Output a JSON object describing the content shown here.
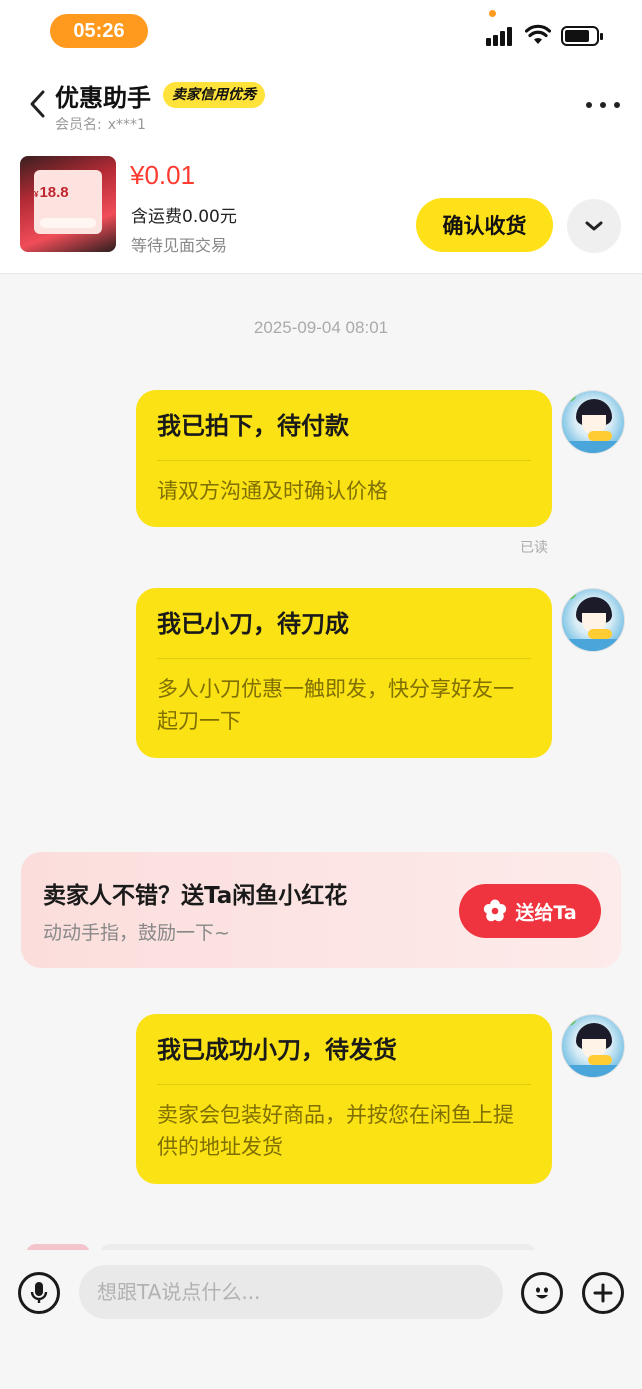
{
  "status_bar": {
    "time": "05:26",
    "accent_color": "#ff9a1f"
  },
  "header": {
    "title": "优惠助手",
    "badge": "卖家信用优秀",
    "member_label": "会员名:",
    "member_value": "x***1",
    "back_icon": "chevron-left-icon",
    "more_icon": "more-dots-icon"
  },
  "product": {
    "thumb_amount": "18.8",
    "thumb_currency": "¥",
    "price": "¥0.01",
    "shipping": "含运费0.00元",
    "status": "等待见面交易",
    "confirm_button": "确认收货",
    "expand_icon": "chevron-down-icon"
  },
  "chat": {
    "timestamp": "2025-09-04 08:01",
    "read_label": "已读",
    "messages": [
      {
        "title": "我已拍下，待付款",
        "body": "请双方沟通及时确认价格"
      },
      {
        "title": "我已小刀，待刀成",
        "body": "多人小刀优惠一触即发，快分享好友一起刀一下"
      },
      {
        "title": "我已成功小刀，待发货",
        "body": "卖家会包装好商品，并按您在闲鱼上提供的地址发货"
      }
    ]
  },
  "flower_card": {
    "title": "卖家人不错？送Ta闲鱼小红花",
    "subtitle": "动动手指，鼓励一下~",
    "button": "送给Ta",
    "button_color": "#f0343f"
  },
  "input_bar": {
    "placeholder": "想跟TA说点什么...",
    "voice_icon": "microphone-icon",
    "emoji_icon": "emoji-icon",
    "plus_icon": "plus-icon"
  },
  "colors": {
    "bubble": "#fae214",
    "price": "#ff3b30",
    "confirm": "#ffe11a"
  }
}
